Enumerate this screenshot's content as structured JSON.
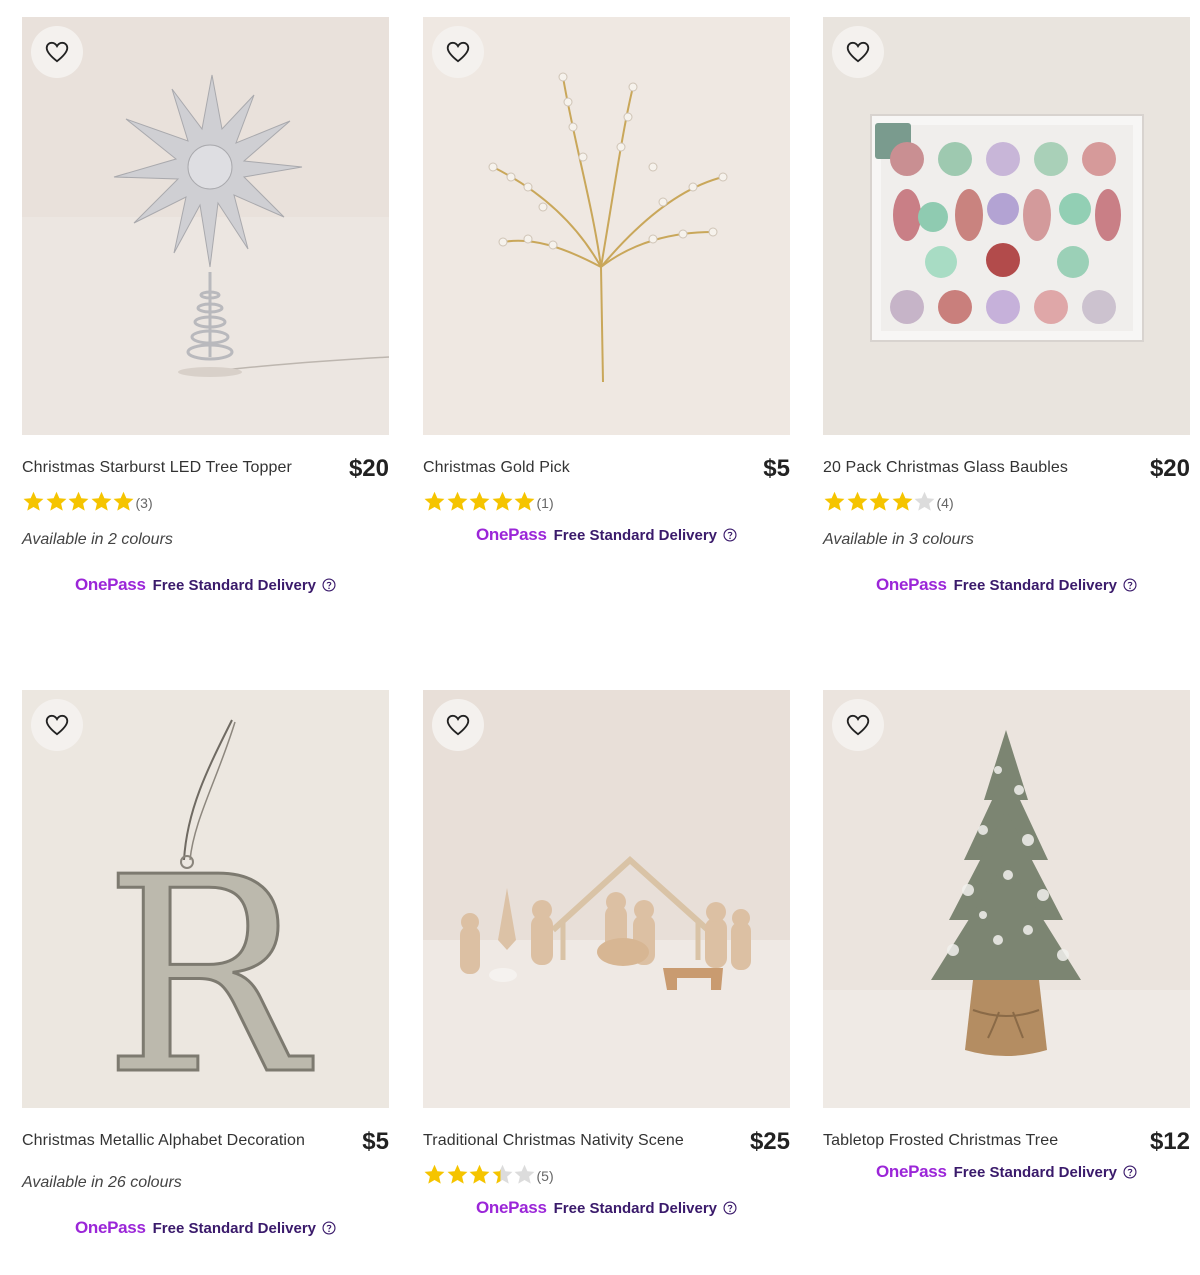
{
  "products": [
    {
      "title": "Christmas Starburst LED Tree Topper",
      "price": "$20",
      "rating": 5,
      "review_count": "(3)",
      "colours_text": "Available in 2 colours",
      "onepass_label": "OnePass",
      "delivery_text": "Free Standard Delivery"
    },
    {
      "title": "Christmas Gold Pick",
      "price": "$5",
      "rating": 5,
      "review_count": "(1)",
      "onepass_label": "OnePass",
      "delivery_text": "Free Standard Delivery"
    },
    {
      "title": "20 Pack Christmas Glass Baubles",
      "price": "$20",
      "rating": 4,
      "review_count": "(4)",
      "colours_text": "Available in 3 colours",
      "onepass_label": "OnePass",
      "delivery_text": "Free Standard Delivery"
    },
    {
      "title": "Christmas Metallic Alphabet Decoration",
      "price": "$5",
      "colours_text": "Available in 26 colours",
      "onepass_label": "OnePass",
      "delivery_text": "Free Standard Delivery"
    },
    {
      "title": "Traditional Christmas Nativity Scene",
      "price": "$25",
      "rating": 3.4,
      "review_count": "(5)",
      "onepass_label": "OnePass",
      "delivery_text": "Free Standard Delivery"
    },
    {
      "title": "Tabletop Frosted Christmas Tree",
      "price": "$12",
      "onepass_label": "OnePass",
      "delivery_text": "Free Standard Delivery"
    }
  ],
  "colors": {
    "star": "#f5c400",
    "star_empty": "#dcdcdc",
    "onepass": "#9b26d8",
    "delivery": "#3a1a6b"
  },
  "icons": {
    "wishlist": "heart-outline-icon",
    "rating": "star-icon",
    "help": "question-circle-icon"
  }
}
